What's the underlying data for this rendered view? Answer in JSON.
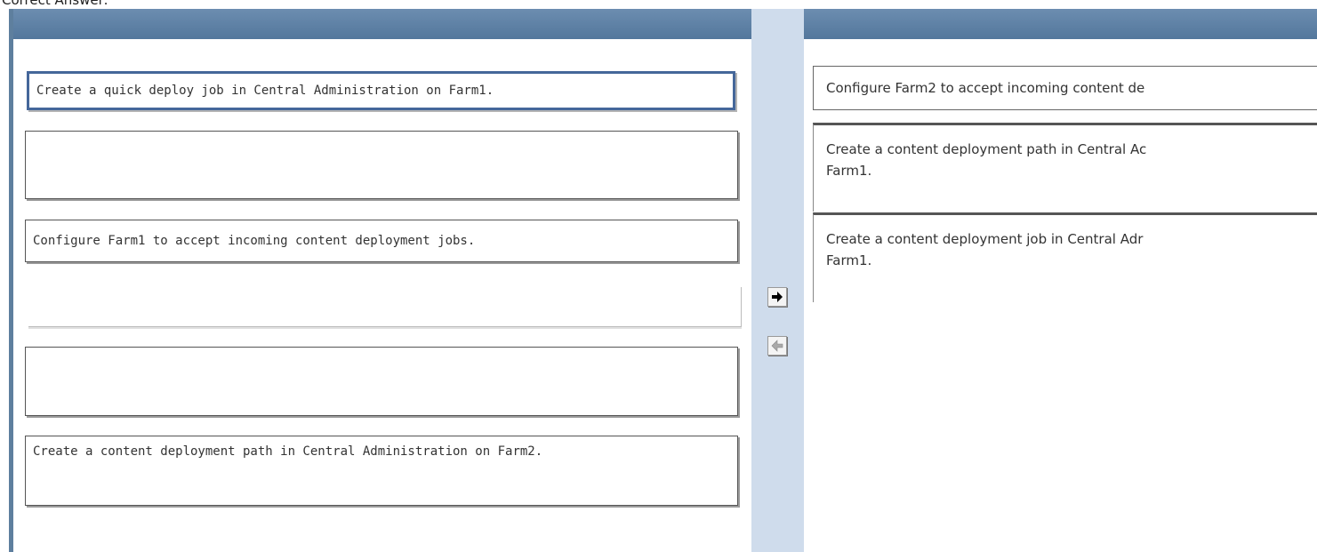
{
  "top_clip_text": "Correct Answer:",
  "left_slots": [
    {
      "text": "Create a quick deploy job in Central Administration on Farm1.",
      "selected": true
    },
    {
      "text": ""
    },
    {
      "text": "Configure Farm1 to accept incoming content deployment jobs."
    },
    {
      "text": ""
    },
    {
      "text": ""
    },
    {
      "text": "Create a content deployment path in Central Administration on Farm2."
    }
  ],
  "right_items": [
    {
      "text": "Configure Farm2 to accept incoming content de"
    },
    {
      "line1": "Create a content deployment path in Central Ac",
      "line2": "Farm1."
    },
    {
      "line1": "Create a content deployment job in Central Adr",
      "line2": "Farm1."
    }
  ],
  "buttons": {
    "move_right_icon": "arrow-right",
    "move_left_icon": "arrow-left"
  },
  "colors": {
    "header_blue": "#5b7fa6",
    "middle_strip": "#cfdcec",
    "selected_border": "#45679a"
  }
}
